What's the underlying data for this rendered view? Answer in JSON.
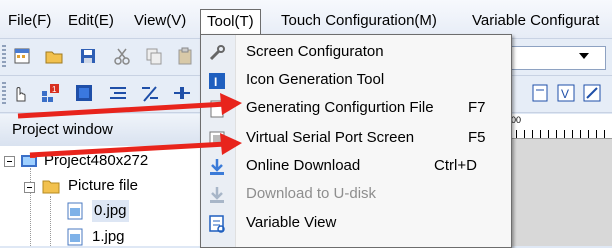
{
  "menubar": {
    "items": [
      {
        "label": "File(F)"
      },
      {
        "label": "Edit(E)"
      },
      {
        "label": "View(V)"
      },
      {
        "label": "Tool(T)",
        "active": true
      },
      {
        "label": "Touch Configuration(M)"
      },
      {
        "label": "Variable Configurat"
      }
    ]
  },
  "combo": {
    "value": "n"
  },
  "project": {
    "title": "Project window",
    "root": "Project480x272",
    "folder": "Picture file",
    "files": [
      "0.jpg",
      "1.jpg"
    ]
  },
  "ruler": {
    "label": "200"
  },
  "tool_menu": {
    "items": [
      {
        "label": "Screen Configuraton",
        "shortcut": "",
        "icon": "screen-config-icon",
        "enabled": true
      },
      {
        "label": "Icon Generation Tool",
        "shortcut": "",
        "icon": "icon-generation-icon",
        "enabled": true
      },
      {
        "label": "Generating Configurtion File",
        "shortcut": "F7",
        "icon": "generate-file-icon",
        "enabled": true
      },
      {
        "label": "Virtual Serial Port Screen",
        "shortcut": "F5",
        "icon": "virtual-serial-icon",
        "enabled": true
      },
      {
        "label": "Online Download",
        "shortcut": "Ctrl+D",
        "icon": "download-icon",
        "enabled": true
      },
      {
        "label": "Download to U-disk",
        "shortcut": "",
        "icon": "udisk-download-icon",
        "enabled": false
      },
      {
        "label": "Variable View",
        "shortcut": "",
        "icon": "variable-view-icon",
        "enabled": true
      }
    ]
  },
  "colors": {
    "arrow": "#e8241c",
    "accent_blue": "#1f5fbf",
    "menu_border": "#6d6d6d"
  }
}
